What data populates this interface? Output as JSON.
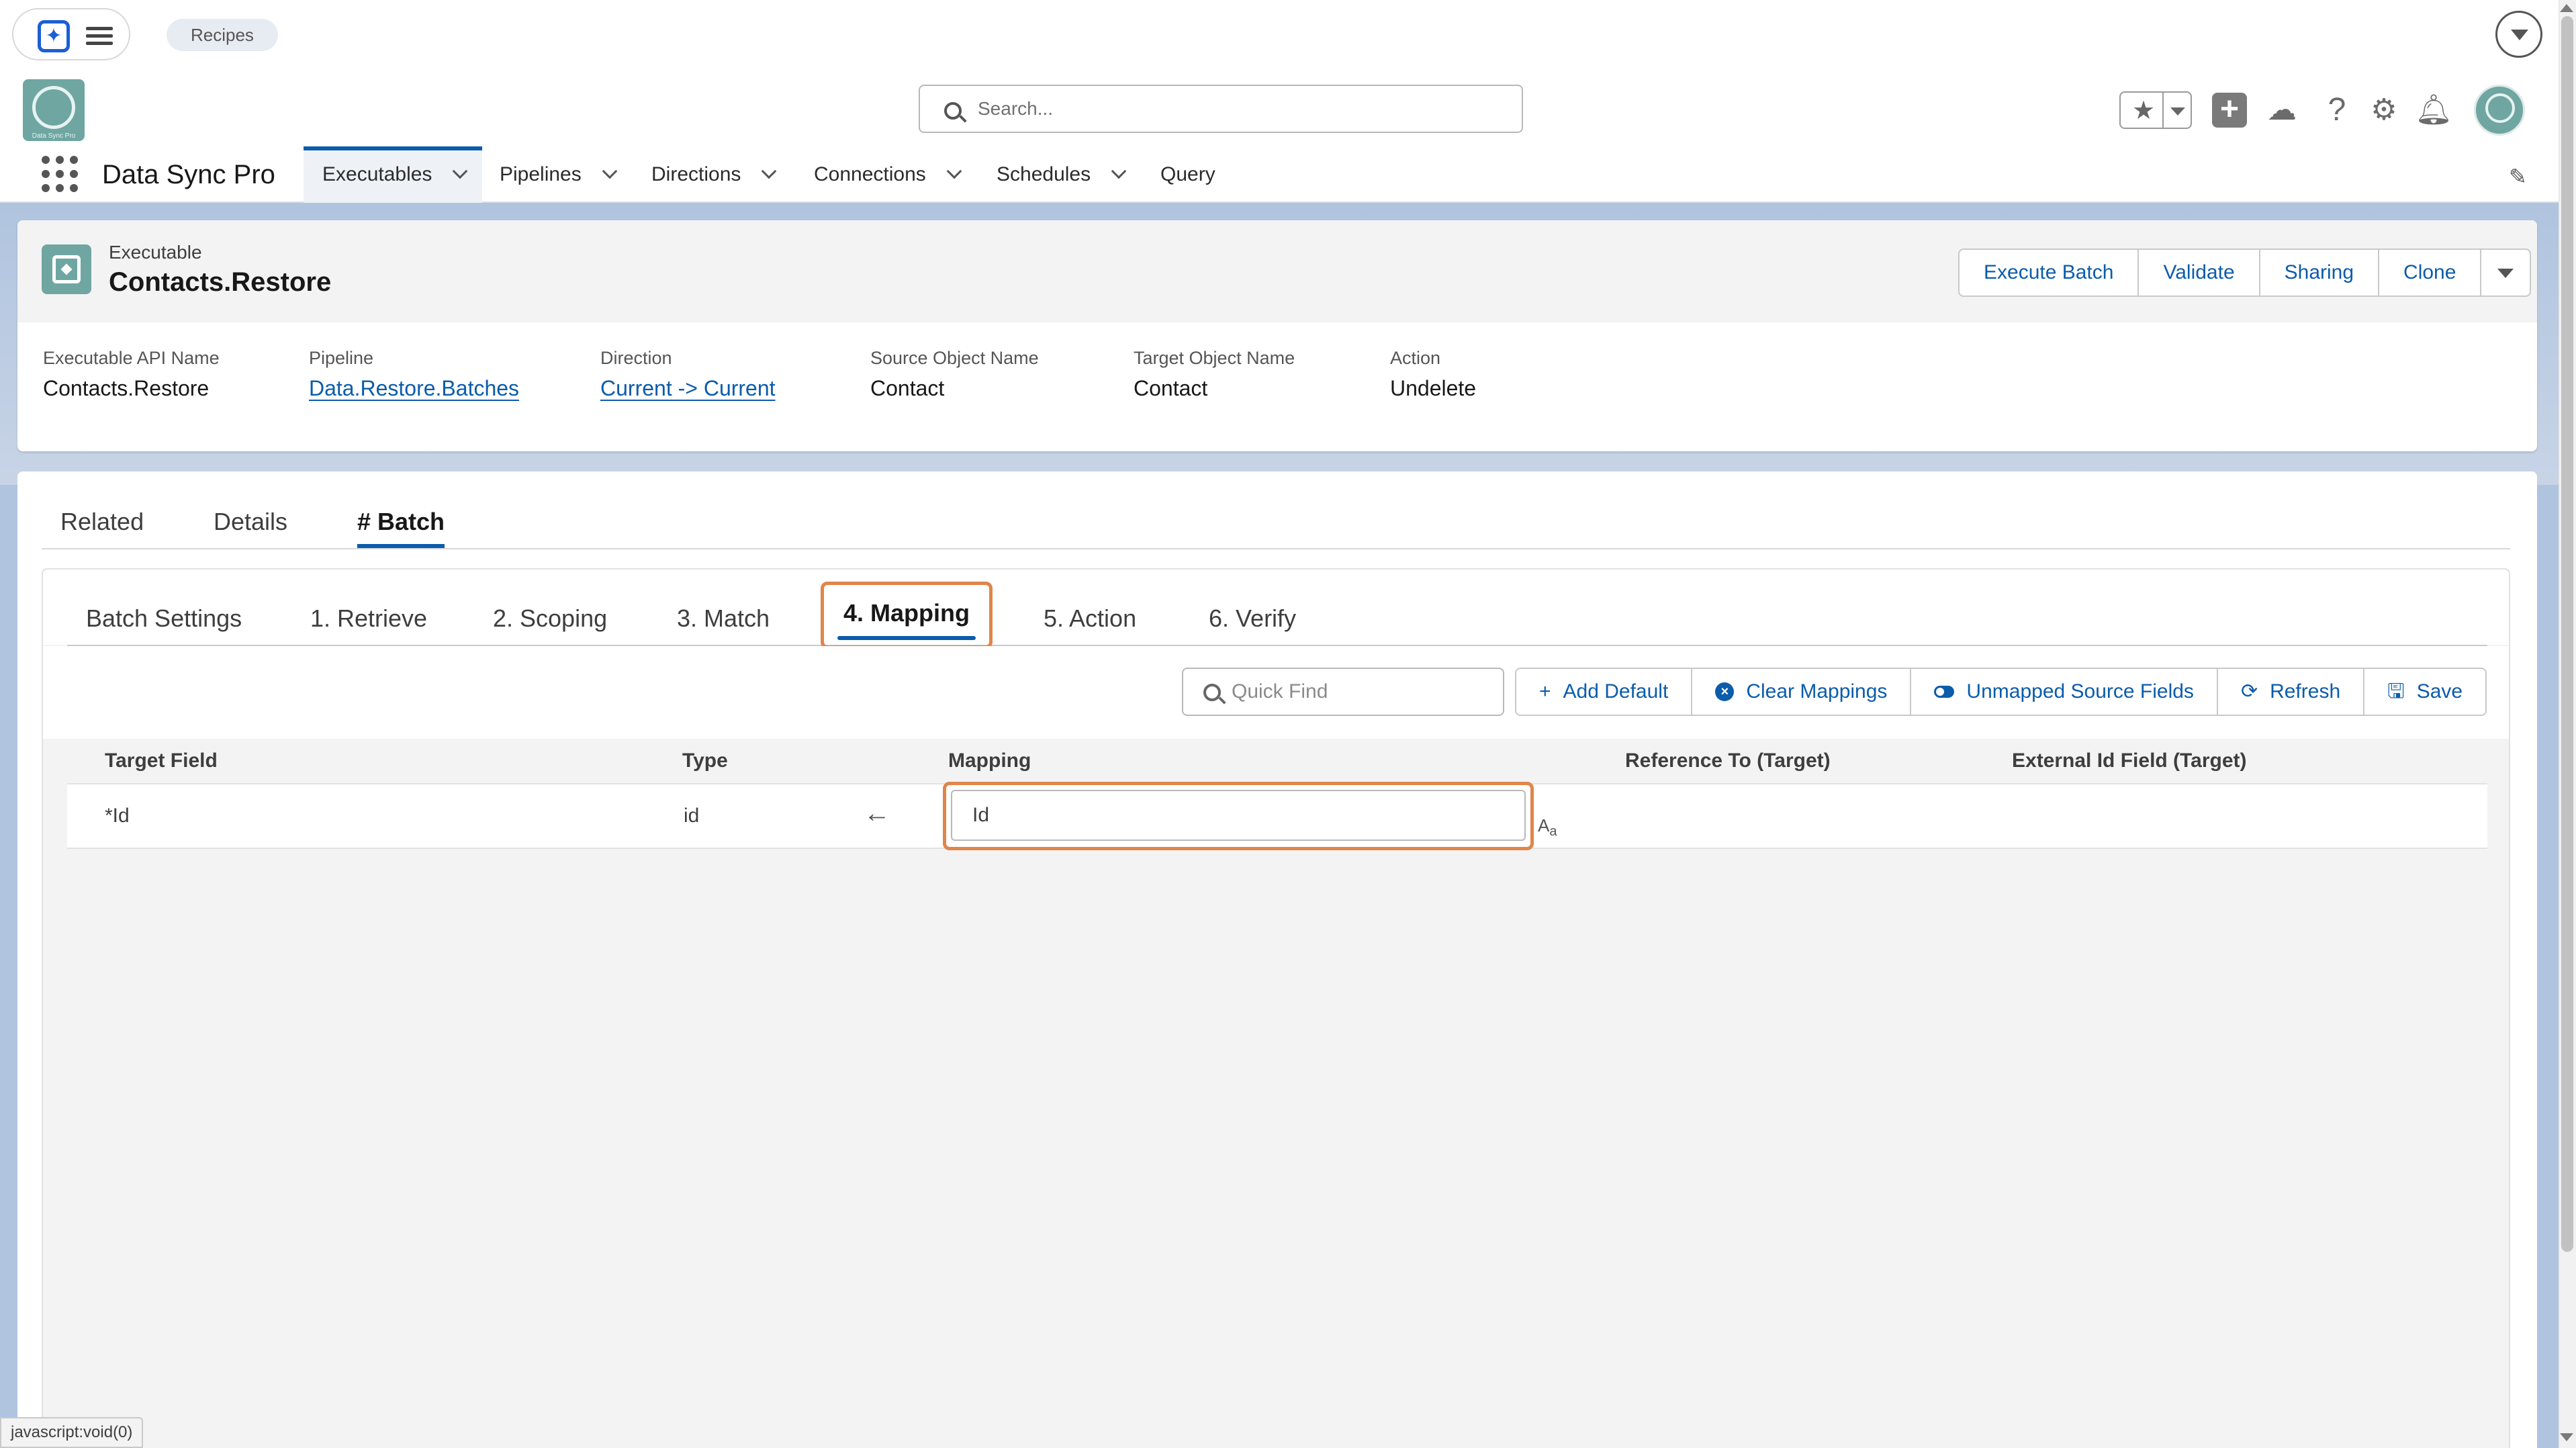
{
  "browser": {
    "recipes_label": "Recipes"
  },
  "header": {
    "search_placeholder": "Search...",
    "app_name": "Data Sync Pro"
  },
  "nav": {
    "tabs": [
      {
        "label": "Executables",
        "has_menu": true,
        "active": true
      },
      {
        "label": "Pipelines",
        "has_menu": true
      },
      {
        "label": "Directions",
        "has_menu": true
      },
      {
        "label": "Connections",
        "has_menu": true
      },
      {
        "label": "Schedules",
        "has_menu": true
      },
      {
        "label": "Query",
        "has_menu": false
      }
    ]
  },
  "record": {
    "object_type": "Executable",
    "title": "Contacts.Restore",
    "actions": [
      "Execute Batch",
      "Validate",
      "Sharing",
      "Clone"
    ],
    "fields": [
      {
        "label": "Executable API Name",
        "value": "Contacts.Restore",
        "link": false
      },
      {
        "label": "Pipeline",
        "value": "Data.Restore.Batches",
        "link": true
      },
      {
        "label": "Direction",
        "value": "Current -> Current",
        "link": true
      },
      {
        "label": "Source Object Name",
        "value": "Contact",
        "link": false
      },
      {
        "label": "Target Object Name",
        "value": "Contact",
        "link": false
      },
      {
        "label": "Action",
        "value": "Undelete",
        "link": false
      }
    ]
  },
  "main_tabs": [
    "Related",
    "Details",
    "# Batch"
  ],
  "active_main_tab": "# Batch",
  "sub_tabs": [
    "Batch Settings",
    "1. Retrieve",
    "2. Scoping",
    "3. Match",
    "4. Mapping",
    "5. Action",
    "6. Verify"
  ],
  "active_sub_tab": "4. Mapping",
  "toolbar": {
    "quick_find_placeholder": "Quick Find",
    "buttons": [
      "Add Default",
      "Clear Mappings",
      "Unmapped Source Fields",
      "Refresh",
      "Save"
    ]
  },
  "table": {
    "columns": [
      "Target Field",
      "Type",
      "Mapping",
      "Reference To (Target)",
      "External Id Field (Target)"
    ],
    "rows": [
      {
        "target_field": "*Id",
        "type": "id",
        "mapping": "Id",
        "reference_to": "",
        "external_id_field": ""
      }
    ]
  },
  "status_bar": "javascript:void(0)",
  "colors": {
    "brand_blue": "#0b5cab",
    "focus_orange": "#e0854a",
    "app_icon_teal": "#6fa6a2",
    "page_bg": "#b0c4df"
  },
  "icons": [
    "sparkle-icon",
    "hamburger-icon",
    "search-icon",
    "star-icon",
    "plus-icon",
    "cloud-icon",
    "help-icon",
    "gear-icon",
    "bell-icon",
    "waffle-icon",
    "pencil-icon",
    "arrow-left-icon",
    "text-case-icon"
  ]
}
